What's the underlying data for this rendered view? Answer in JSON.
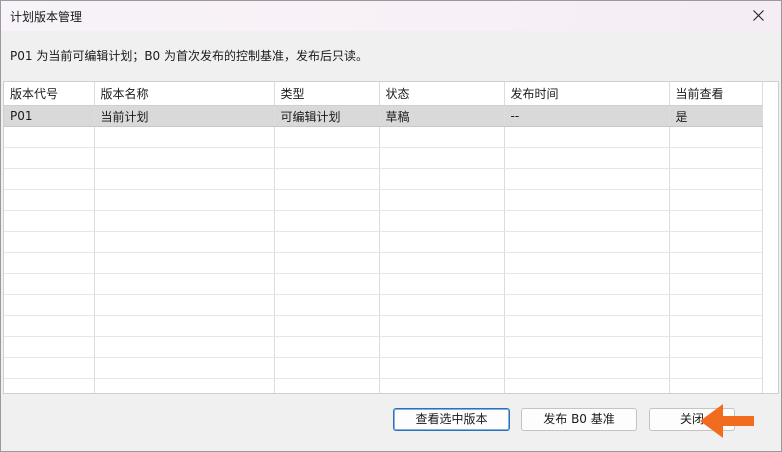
{
  "window": {
    "title": "计划版本管理",
    "description": "P01 为当前可编辑计划；B0 为首次发布的控制基准，发布后只读。"
  },
  "table": {
    "columns": [
      "版本代号",
      "版本名称",
      "类型",
      "状态",
      "发布时间",
      "当前查看"
    ],
    "rows": [
      [
        "P01",
        "当前计划",
        "可编辑计划",
        "草稿",
        "--",
        "是"
      ]
    ]
  },
  "buttons": {
    "view_selected": "查看选中版本",
    "publish_b0": "发布 B0 基准",
    "close": "关闭"
  },
  "colors": {
    "selected_row": "#d9d9d9",
    "arrow": "#f26c1f",
    "primary_border": "#2f6fb8"
  }
}
